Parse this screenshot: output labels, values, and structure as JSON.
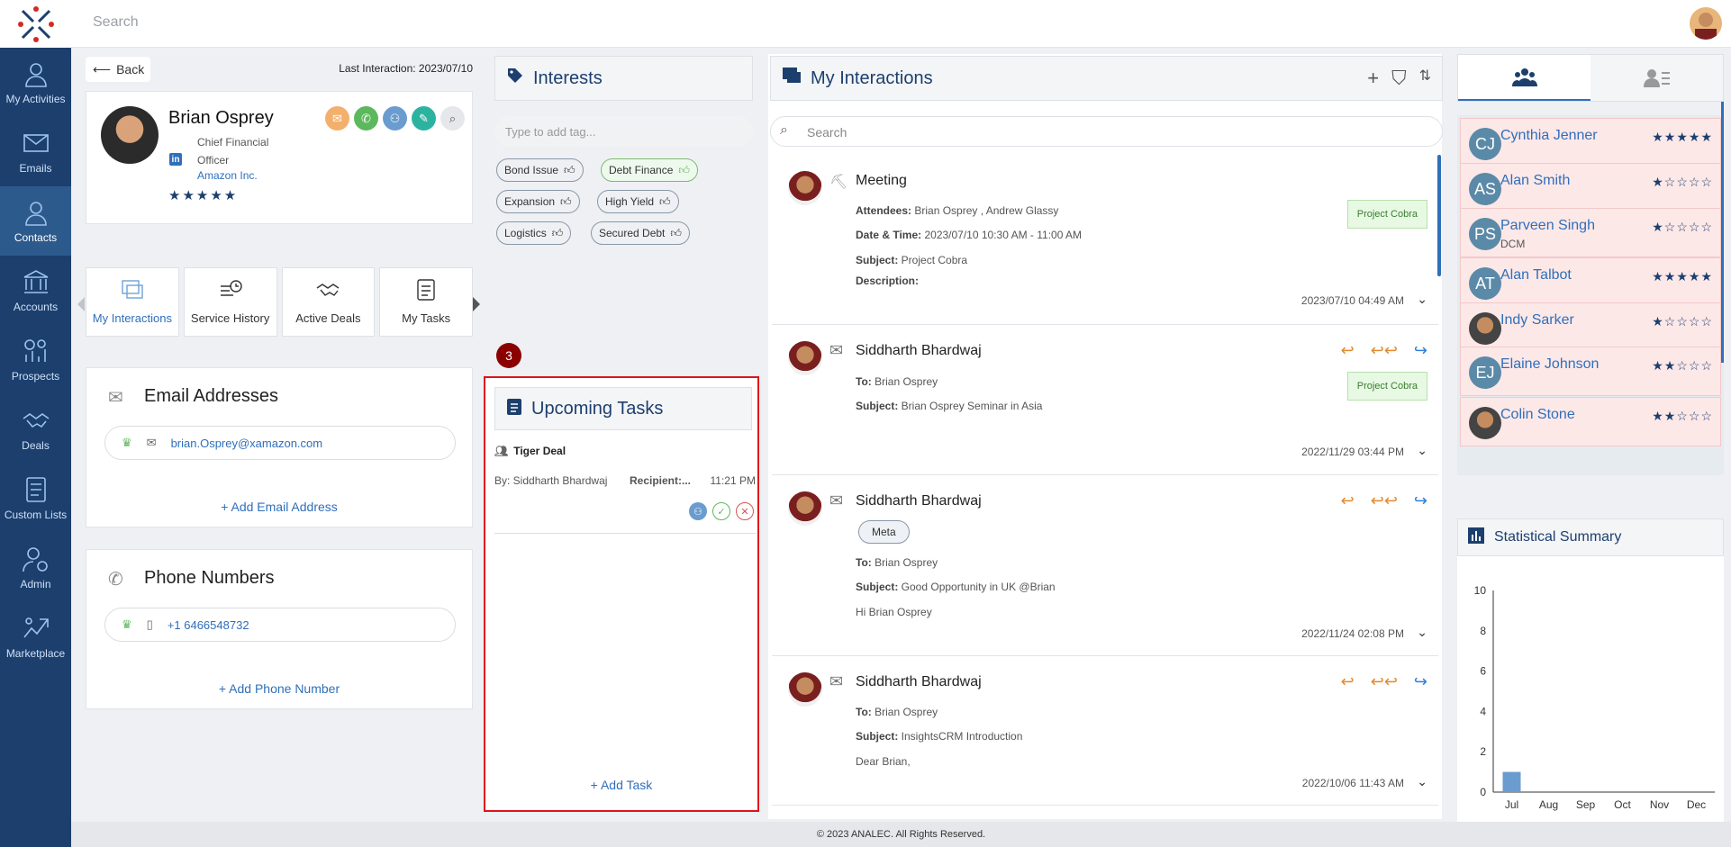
{
  "topbar": {
    "search_placeholder": "Search"
  },
  "nav": [
    {
      "label": "My Activities",
      "icon": "user-icon"
    },
    {
      "label": "Emails",
      "icon": "mail-icon"
    },
    {
      "label": "Contacts",
      "icon": "contact-icon",
      "active": true
    },
    {
      "label": "Accounts",
      "icon": "bank-icon"
    },
    {
      "label": "Prospects",
      "icon": "prospect-icon"
    },
    {
      "label": "Deals",
      "icon": "handshake-icon"
    },
    {
      "label": "Custom Lists",
      "icon": "list-icon"
    },
    {
      "label": "Admin",
      "icon": "admin-icon"
    },
    {
      "label": "Marketplace",
      "icon": "marketplace-icon"
    }
  ],
  "profile": {
    "back_label": "Back",
    "last_interaction": "Last Interaction: 2023/07/10",
    "name": "Brian Osprey",
    "title": "Chief Financial Officer",
    "company": "Amazon Inc.",
    "stars": "★★★★★"
  },
  "tabs": [
    "My Interactions",
    "Service History",
    "Active Deals",
    "My Tasks"
  ],
  "email": {
    "title": "Email Addresses",
    "value": "brian.Osprey@xamazon.com",
    "add": "+ Add Email Address"
  },
  "phone": {
    "title": "Phone Numbers",
    "value": "+1 6466548732",
    "add": "+ Add Phone Number"
  },
  "interests": {
    "title": "Interests",
    "placeholder": "Type to add tag...",
    "tags": [
      "Bond Issue",
      "Debt Finance",
      "Expansion",
      "High Yield",
      "Logistics",
      "Secured Debt"
    ]
  },
  "tasks": {
    "badge": "3",
    "title": "Upcoming Tasks",
    "task_name": "Tiger Deal",
    "by": "By: Siddharth Bhardwaj",
    "recipient": "Recipient:...",
    "time": "11:21 PM",
    "add": "+ Add Task"
  },
  "interactions": {
    "title": "My Interactions",
    "search_placeholder": "Search",
    "items": [
      {
        "title": "Meeting",
        "l1k": "Attendees:",
        "l1v": " Brian Osprey , Andrew Glassy",
        "l2k": "Date & Time:",
        "l2v": " 2023/07/10 10:30 AM - 11:00 AM",
        "l3k": "Subject:",
        "l3v": " Project Cobra",
        "l4k": "Description:",
        "tag": "Project Cobra",
        "date": "2023/07/10 04:49 AM"
      },
      {
        "title": "Siddharth Bhardwaj",
        "l1k": "To:",
        "l1v": " Brian Osprey",
        "l2k": "Subject:",
        "l2v": " Brian Osprey Seminar in Asia",
        "tag": "Project Cobra",
        "date": "2022/11/29 03:44 PM"
      },
      {
        "title": "Siddharth Bhardwaj",
        "chip": "Meta",
        "l1k": "To:",
        "l1v": " Brian Osprey",
        "l2k": "Subject:",
        "l2v": " Good Opportunity in UK @Brian",
        "body": "Hi Brian Osprey",
        "date": "2022/11/24 02:08 PM"
      },
      {
        "title": "Siddharth Bhardwaj",
        "l1k": "To:",
        "l1v": " Brian Osprey",
        "l2k": "Subject:",
        "l2v": " InsightsCRM Introduction",
        "body": "Dear Brian,",
        "date": "2022/10/06 11:43 AM"
      }
    ]
  },
  "contacts": [
    {
      "ini": "CJ",
      "name": "Cynthia Jenner",
      "sub": "",
      "stars": "★★★★★"
    },
    {
      "ini": "AS",
      "name": "Alan Smith",
      "sub": "",
      "stars": "★☆☆☆☆"
    },
    {
      "ini": "PS",
      "name": "Parveen Singh",
      "sub": "DCM",
      "stars": "★☆☆☆☆"
    },
    {
      "ini": "AT",
      "name": "Alan Talbot",
      "sub": "",
      "stars": "★★★★★"
    },
    {
      "ini": "",
      "name": "Indy Sarker",
      "sub": "",
      "stars": "★☆☆☆☆"
    },
    {
      "ini": "EJ",
      "name": "Elaine Johnson",
      "sub": "",
      "stars": "★★☆☆☆"
    },
    {
      "ini": "",
      "name": "Colin Stone",
      "sub": "",
      "stars": "★★☆☆☆"
    }
  ],
  "stats": {
    "title": "Statistical Summary"
  },
  "chart_data": {
    "type": "bar",
    "categories": [
      "Jul",
      "Aug",
      "Sep",
      "Oct",
      "Nov",
      "Dec"
    ],
    "values": [
      1,
      0,
      0,
      0,
      0,
      0
    ],
    "ylim": [
      0,
      10
    ],
    "yticks": [
      "0",
      "2",
      "4",
      "6",
      "8",
      "10"
    ],
    "color": "#6a9ccf"
  },
  "footer": "© 2023 ANALEC. All Rights Reserved."
}
